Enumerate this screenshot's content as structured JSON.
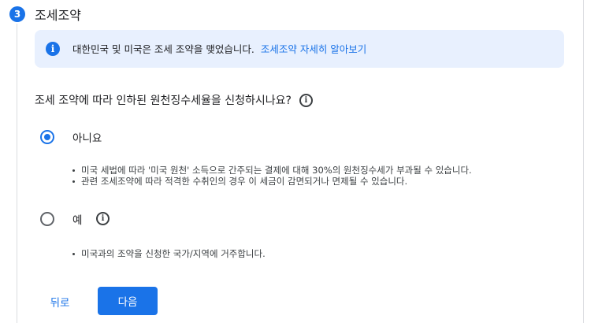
{
  "step": {
    "number": "3",
    "title": "조세조약"
  },
  "info": {
    "text": "대한민국 및 미국은 조세 조약을 맺었습니다.",
    "link": "조세조약 자세히 알아보기"
  },
  "question": {
    "text": "조세 조약에 따라 인하된 원천징수세율을 신청하시나요?",
    "help_icon": "i"
  },
  "options": {
    "no": {
      "label": "아니요",
      "selected": true,
      "bullets": [
        "미국 세법에 따라 '미국 원천' 소득으로 간주되는 결제에 대해 30%의 원천징수세가 부과될 수 있습니다.",
        "관련 조세조약에 따라 적격한 수취인의 경우 이 세금이 감면되거나 면제될 수 있습니다."
      ]
    },
    "yes": {
      "label": "예",
      "selected": false,
      "help_icon": "i",
      "bullets": [
        "미국과의 조약을 신청한 국가/지역에 거주합니다."
      ]
    }
  },
  "buttons": {
    "back": "뒤로",
    "next": "다음"
  },
  "colors": {
    "accent": "#1a73e8",
    "info_background": "#e8f0fe"
  }
}
